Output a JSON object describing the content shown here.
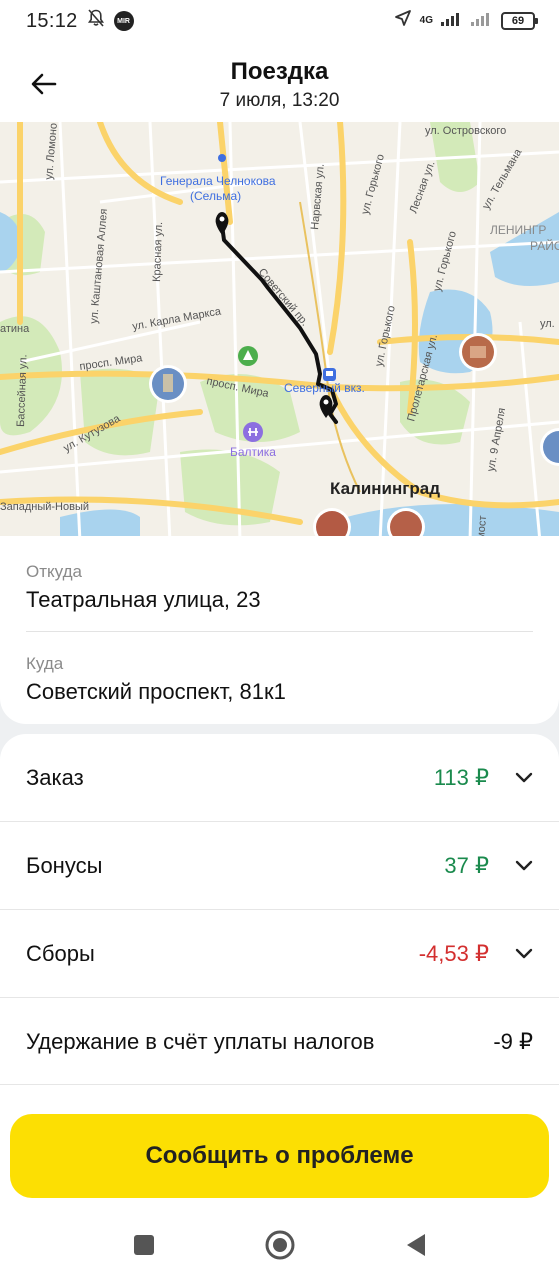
{
  "status_bar": {
    "time": "15:12",
    "network": "4G",
    "battery": "69",
    "icons": [
      "bell-off-icon",
      "mir-pay-icon",
      "location-arrow-icon",
      "signal-icon",
      "signal-icon-2",
      "battery-icon"
    ]
  },
  "header": {
    "title": "Поездка",
    "subtitle": "7 июля, 13:20"
  },
  "map": {
    "labels": {
      "ostrovsky": "ул. Островского",
      "chelnokova_1": "Генерала Челнокова",
      "chelnokova_2": "(Сельма)",
      "gorkogo_top": "ул. Горького",
      "narvskaya": "Нарвская ул.",
      "lesnaya": "Лесная ул.",
      "telmana": "ул. Тельмана",
      "leningr": "ЛЕНИНГР",
      "rayon": "РАЙО",
      "lomonosova": "ул. Ломоно",
      "kashtanovaya": "ул. Каштановая Аллея",
      "krasnaya": "Красная ул.",
      "karla_marksa": "ул. Карла Маркса",
      "sovetsky": "Советский пр.",
      "gorkogo_2": "ул. Горького",
      "gorkogo_3": "ул. Горького",
      "proletarskaya": "Пролетарская ул.",
      "mira_1": "просп. Мира",
      "mira_2": "просп. Мира",
      "severny": "Северный вкз.",
      "basseynaya": "Бассейная ул.",
      "kutuzova": "ул. Кутузова",
      "baltika": "Балтика",
      "aprelya": "ул. 9 Апреля",
      "kaliningrad": "Калининград",
      "zapadny": "Западный-Новый",
      "most": "мост",
      "latina": "атина",
      "ul_right": "ул."
    },
    "colors": {
      "route": "#000000",
      "road_major": "#fbd96b",
      "park": "#cfe8b4",
      "water": "#a8d4ef"
    }
  },
  "trip": {
    "from_caption": "Откуда",
    "from_value": "Театральная улица, 23",
    "to_caption": "Куда",
    "to_value": "Советский проспект, 81к1"
  },
  "payment": {
    "rows": [
      {
        "label": "Заказ",
        "amount": "113 ₽",
        "tone": "green"
      },
      {
        "label": "Бонусы",
        "amount": "37 ₽",
        "tone": "green"
      },
      {
        "label": "Сборы",
        "amount": "-4,53 ₽",
        "tone": "red"
      },
      {
        "label": "Удержание в счёт уплаты налогов",
        "amount": "-9 ₽",
        "tone": "neutral"
      }
    ]
  },
  "actions": {
    "report_label": "Сообщить о проблеме",
    "report_color": "#fcdf03"
  }
}
